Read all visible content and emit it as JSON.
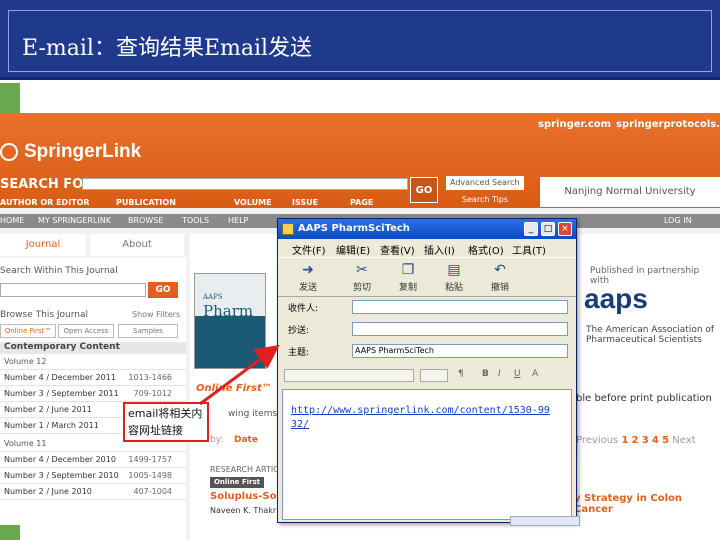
{
  "slide": {
    "title": "E-mail：查询结果Email发送"
  },
  "springer": {
    "top_links": [
      "springer.com",
      "springerprotocols.com"
    ],
    "logo": "SpringerLink",
    "search_for": "SEARCH FOR",
    "go": "GO",
    "advanced_search": "Advanced Search",
    "search_tips": "Search Tips",
    "institution": "Nanjing Normal University",
    "fields": {
      "author": "AUTHOR OR EDITOR",
      "publication": "PUBLICATION",
      "volume": "VOLUME",
      "issue": "ISSUE",
      "page": "PAGE"
    },
    "nav": [
      "HOME",
      "MY SPRINGERLINK",
      "BROWSE",
      "TOOLS",
      "HELP",
      "LOG IN"
    ],
    "tabs": {
      "journal": "Journal",
      "about": "About"
    },
    "search_within": "Search Within This Journal",
    "browse_journal": "Browse This Journal",
    "show_filters": "Show Filters",
    "filter_tabs": [
      "Online First™",
      "Open Access",
      "Samples"
    ],
    "contemporary": "Contemporary Content",
    "volume12": "Volume 12",
    "volume11": "Volume 11",
    "issues12": [
      {
        "label": "Number 4 / December 2011",
        "pages": "1013-1466"
      },
      {
        "label": "Number 3 / September 2011",
        "pages": "709-1012"
      },
      {
        "label": "Number 2 / June 2011",
        "pages": "495-776"
      },
      {
        "label": "Number 1 / March 2011",
        "pages": "1-494"
      }
    ],
    "issues11": [
      {
        "label": "Number 4 / December 2010",
        "pages": "1499-1757"
      },
      {
        "label": "Number 3 / September 2010",
        "pages": "1005-1498"
      },
      {
        "label": "Number 2 / June 2010",
        "pages": "407-1004"
      }
    ],
    "cover": {
      "line1": "AAPS",
      "line2": "Pharm",
      "line3": "SciTech"
    },
    "online_first": "Online First™",
    "published_partnership": "Published in partnership with",
    "aaps_logo": "aaps",
    "aaps_desc": "The American Association of Pharmaceutical Scientists",
    "pub_before_print": "ble before print publication",
    "pager": {
      "prev": "Previous",
      "pages": [
        "1",
        "2",
        "3",
        "4",
        "5"
      ],
      "next": "Next"
    },
    "research_article": "RESEARCH ARTICLE",
    "of_badge": "Online First",
    "soluplus": "Soluplus-Solu",
    "authors": "Naveen K. Thakr",
    "strategy": "y Strategy in Colon Cancer",
    "showing_items": "wing items 1 -",
    "sort_by": "rt by:",
    "sort_date": "Date"
  },
  "dialog": {
    "title": "AAPS PharmSciTech",
    "menu": [
      "文件(F)",
      "编辑(E)",
      "查看(V)",
      "插入(I)",
      "格式(O)",
      "工具(T)"
    ],
    "toolbar": [
      {
        "label": "发送",
        "icon": "send-icon"
      },
      {
        "label": "剪切",
        "icon": "cut-icon"
      },
      {
        "label": "复制",
        "icon": "copy-icon"
      },
      {
        "label": "粘贴",
        "icon": "paste-icon"
      },
      {
        "label": "撤销",
        "icon": "undo-icon"
      }
    ],
    "to_label": "收件人:",
    "cc_label": "抄送:",
    "subject_label": "主题:",
    "to_value": "",
    "cc_value": "",
    "subject_value": "AAPS PharmSciTech",
    "body_link": "http://www.springerlink.com/content/1530-9932/"
  },
  "annotation": {
    "text": "email将相关内容网址链接"
  }
}
